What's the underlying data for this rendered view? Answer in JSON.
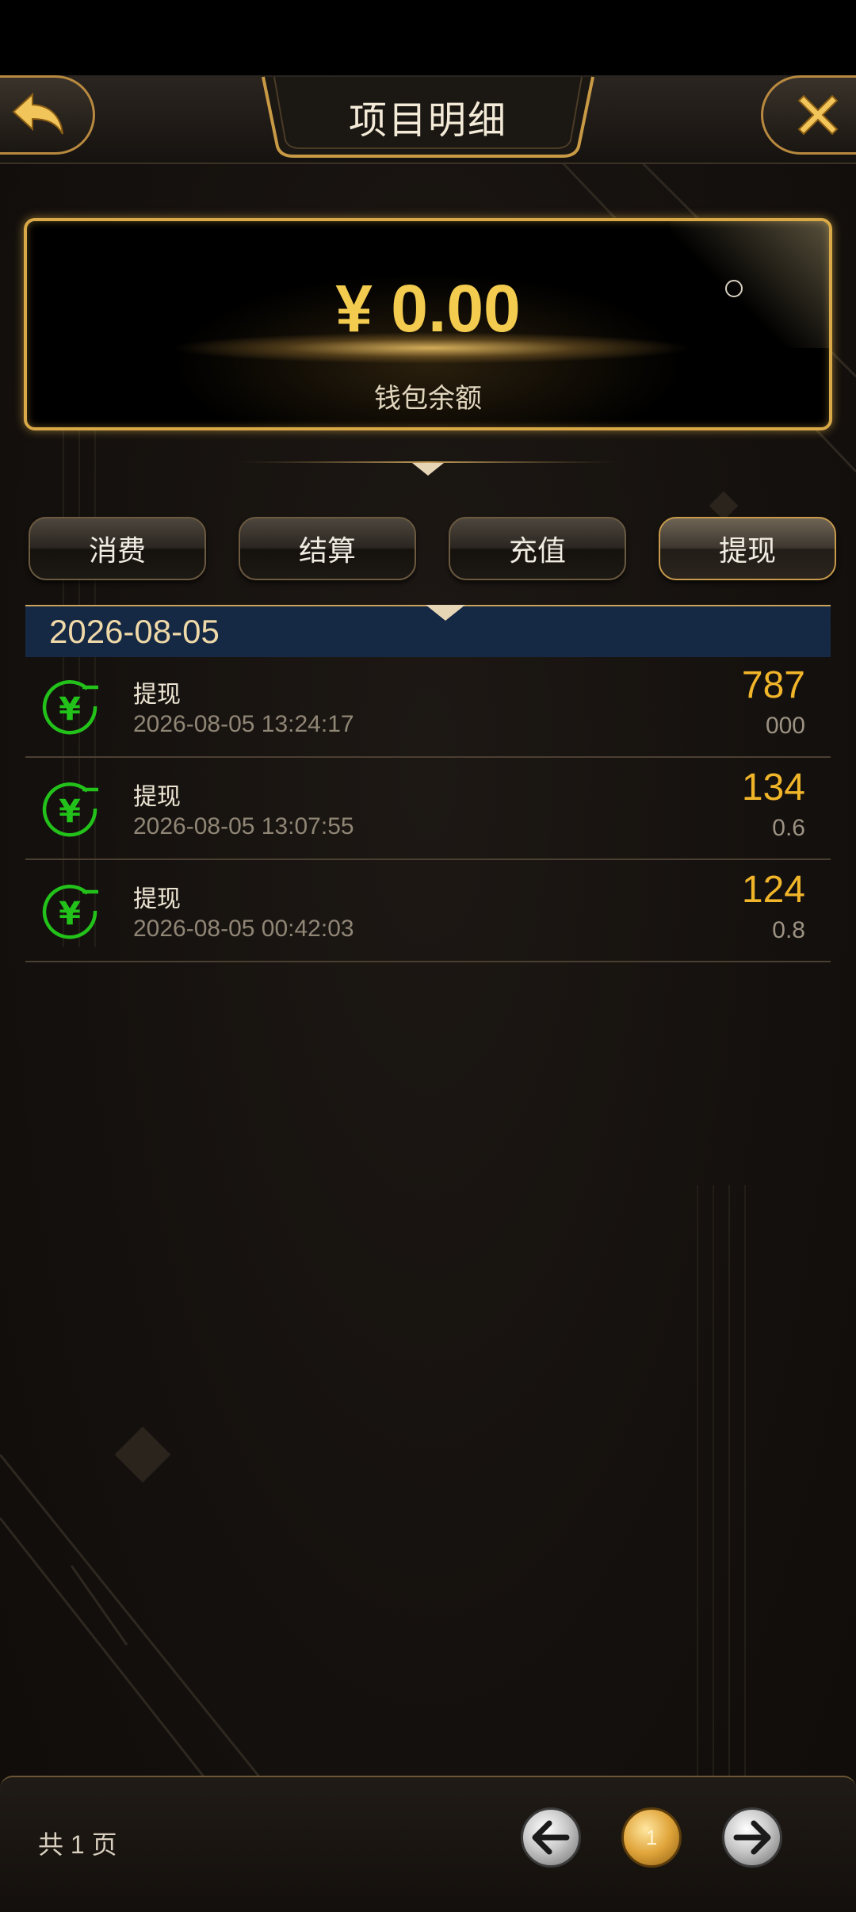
{
  "header": {
    "title": "项目明细"
  },
  "balance": {
    "amount": "¥ 0.00",
    "label": "钱包余额"
  },
  "tabs": [
    {
      "label": "消费"
    },
    {
      "label": "结算"
    },
    {
      "label": "充值"
    },
    {
      "label": "提现"
    }
  ],
  "active_tab": "提现",
  "date_group": "2026-08-05",
  "records": [
    {
      "type": "提现",
      "time": "2026-08-05 13:24:17",
      "amount": "787",
      "sub": "000"
    },
    {
      "type": "提现",
      "time": "2026-08-05 13:07:55",
      "amount": "134",
      "sub": "0.6"
    },
    {
      "type": "提现",
      "time": "2026-08-05 00:42:03",
      "amount": "124",
      "sub": "0.8"
    }
  ],
  "pagination": {
    "info": "共 1 页",
    "current": "1"
  },
  "colors": {
    "gold": "#d9a948",
    "amount": "#f1b52a",
    "icon_green": "#22c21a",
    "date_bar": "#152844"
  },
  "icons": {
    "back": "back-arrow-icon",
    "close": "close-icon",
    "refresh": "refresh-icon",
    "record": "yuan-withdraw-icon",
    "prev": "arrow-left-icon",
    "next": "arrow-right-icon"
  }
}
